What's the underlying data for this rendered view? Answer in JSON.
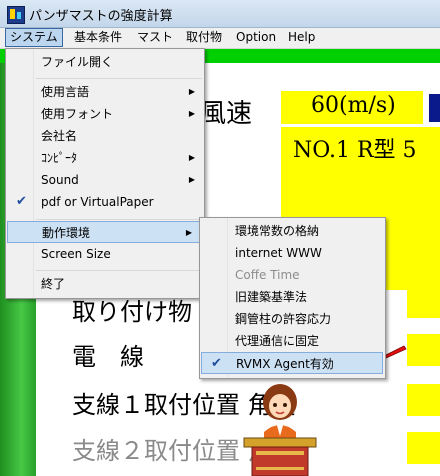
{
  "window": {
    "title": "パンザマストの強度計算"
  },
  "menubar": {
    "items": [
      "システム",
      "基本条件",
      "マスト",
      "取付物",
      "Option",
      "Help"
    ]
  },
  "background": {
    "wind_label": "風速",
    "wind_value": "60(m/s)",
    "type_label": "NO.1 R型 5",
    "row1": "取り付け物",
    "row2": "電　線",
    "row3": "支線１取付位置 角度",
    "row4": "支線２取付位置 角度"
  },
  "system_menu": {
    "open_file": "ファイル開く",
    "language": "使用言語",
    "font": "使用フォント",
    "company": "会社名",
    "computer": "ｺﾝﾋﾟｰﾀ",
    "sound": "Sound",
    "pdf": "pdf or VirtualPaper",
    "environment": "動作環境",
    "screen_size": "Screen Size",
    "exit": "終了"
  },
  "env_submenu": {
    "store_constants": "環境常数の格納",
    "internet": "internet WWW",
    "coffe_time": "Coffe Time",
    "old_law": "旧建築基準法",
    "steel_pole": "鋼管柱の許容応力",
    "comm_fixed": "代理通信に固定",
    "rvmx": "RVMX Agent有効"
  },
  "colors": {
    "highlight": "#cde1f5",
    "check": "#1f4d9e",
    "accent_green": "#00d000",
    "accent_yellow": "#ffff00"
  }
}
